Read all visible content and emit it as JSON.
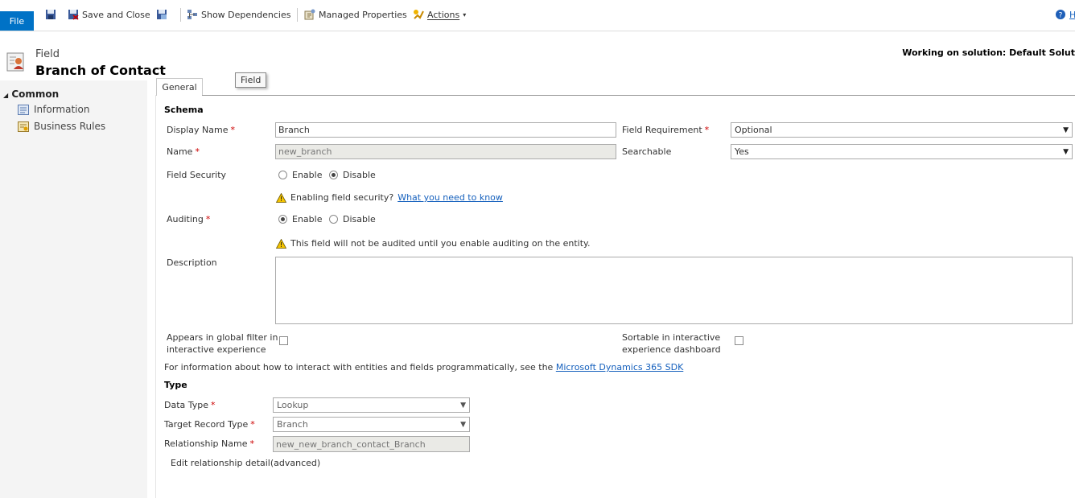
{
  "toolbar": {
    "file_label": "File",
    "save_and_close": "Save and Close",
    "show_dependencies": "Show Dependencies",
    "managed_properties": "Managed Properties",
    "actions": "Actions",
    "help_label": "H"
  },
  "header": {
    "entity_type": "Field",
    "title": "Branch of Contact",
    "solution": "Working on solution: Default Solut"
  },
  "nav": {
    "group": "Common",
    "items": [
      "Information",
      "Business Rules"
    ]
  },
  "tabs": {
    "general": "General",
    "tooltip": "Field"
  },
  "schema": {
    "heading": "Schema",
    "display_name_label": "Display Name",
    "display_name_value": "Branch",
    "name_label": "Name",
    "name_value": "new_branch",
    "field_requirement_label": "Field Requirement",
    "field_requirement_value": "Optional",
    "searchable_label": "Searchable",
    "searchable_value": "Yes",
    "field_security_label": "Field Security",
    "field_security_options": [
      "Enable",
      "Disable"
    ],
    "field_security_selected": "Disable",
    "security_warning_text": "Enabling field security?",
    "security_warning_link": "What you need to know",
    "auditing_label": "Auditing",
    "auditing_options": [
      "Enable",
      "Disable"
    ],
    "auditing_selected": "Enable",
    "auditing_warning": "This field will not be audited until you enable auditing on the entity.",
    "description_label": "Description",
    "description_value": "",
    "global_filter_label_1": "Appears in global filter in",
    "global_filter_label_2": "interactive experience",
    "sortable_label_1": "Sortable in interactive",
    "sortable_label_2": "experience dashboard",
    "sdk_text": "For information about how to interact with entities and fields programmatically, see the",
    "sdk_link": "Microsoft Dynamics 365 SDK"
  },
  "type": {
    "heading": "Type",
    "data_type_label": "Data Type",
    "data_type_value": "Lookup",
    "target_record_label": "Target Record Type",
    "target_record_value": "Branch",
    "relationship_label": "Relationship Name",
    "relationship_value": "new_new_branch_contact_Branch",
    "edit_relationship": "Edit relationship detail(advanced)"
  },
  "colors": {
    "file_button": "#0072c6",
    "required_marker": "#cc0000",
    "link": "#1560bd",
    "warning": "#f5c400"
  },
  "icons": [
    "save-icon",
    "save-close-icon",
    "save-as-icon",
    "dependencies-icon",
    "managed-properties-icon",
    "actions-icon",
    "help-icon",
    "entity-field-icon",
    "information-icon",
    "business-rules-icon",
    "warning-icon"
  ]
}
